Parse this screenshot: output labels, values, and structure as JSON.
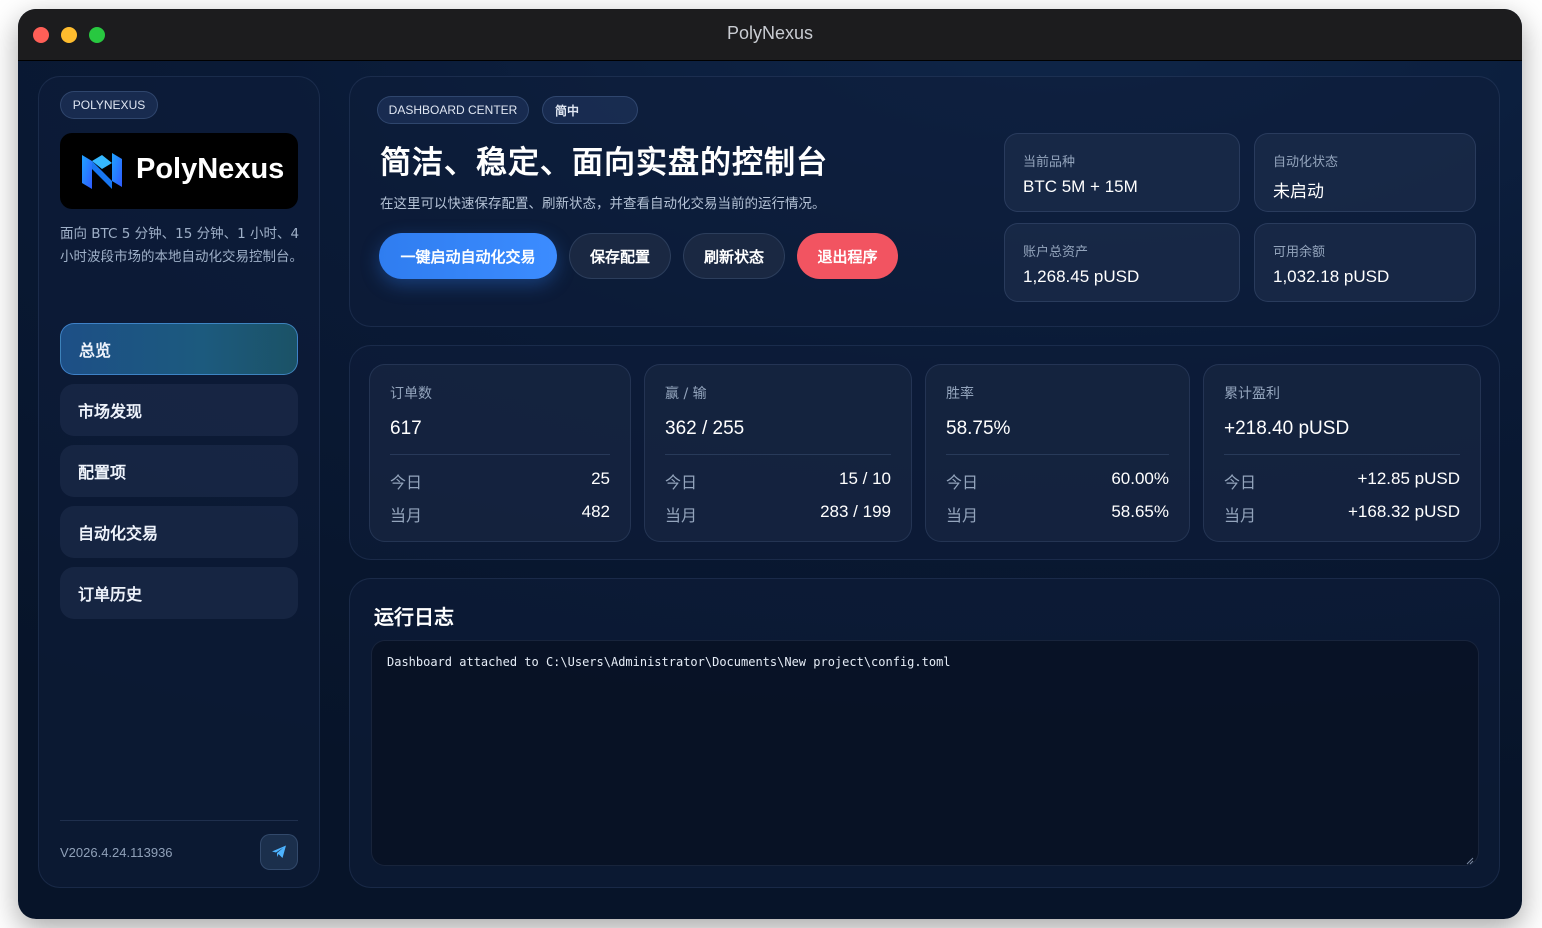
{
  "window": {
    "title": "PolyNexus"
  },
  "sidebar": {
    "badge": "POLYNEXUS",
    "logo_text": "PolyNexus",
    "description": "面向 BTC 5 分钟、15 分钟、1 小时、4 小时波段市场的本地自动化交易控制台。",
    "items": [
      {
        "label": "总览",
        "active": true
      },
      {
        "label": "市场发现",
        "active": false
      },
      {
        "label": "配置项",
        "active": false
      },
      {
        "label": "自动化交易",
        "active": false
      },
      {
        "label": "订单历史",
        "active": false
      }
    ],
    "version": "V2026.4.24.113936",
    "telegram_icon": "paper-plane-icon"
  },
  "hero": {
    "tag": "DASHBOARD CENTER",
    "lang": "简中",
    "title": "简洁、稳定、面向实盘的控制台",
    "subtitle": "在这里可以快速保存配置、刷新状态，并查看自动化交易当前的运行情况。",
    "buttons": {
      "start": "一键启动自动化交易",
      "save": "保存配置",
      "refresh": "刷新状态",
      "exit": "退出程序"
    },
    "cards": [
      {
        "label": "当前品种",
        "value": "BTC 5M + 15M"
      },
      {
        "label": "自动化状态",
        "value": "未启动"
      },
      {
        "label": "账户总资产",
        "value": "1,268.45 pUSD"
      },
      {
        "label": "可用余额",
        "value": "1,032.18 pUSD"
      }
    ]
  },
  "stats": [
    {
      "label": "订单数",
      "value": "617",
      "today_label": "今日",
      "today": "25",
      "month_label": "当月",
      "month": "482"
    },
    {
      "label": "赢 / 输",
      "value": "362 / 255",
      "today_label": "今日",
      "today": "15 / 10",
      "month_label": "当月",
      "month": "283 / 199"
    },
    {
      "label": "胜率",
      "value": "58.75%",
      "today_label": "今日",
      "today": "60.00%",
      "month_label": "当月",
      "month": "58.65%"
    },
    {
      "label": "累计盈利",
      "value": "+218.40 pUSD",
      "today_label": "今日",
      "today": "+12.85 pUSD",
      "month_label": "当月",
      "month": "+168.32 pUSD"
    }
  ],
  "log": {
    "title": "运行日志",
    "content": "Dashboard attached to C:\\Users\\Administrator\\Documents\\New project\\config.toml"
  },
  "colors": {
    "accent": "#3c8cff",
    "danger": "#f25461",
    "background": "#0a1a36"
  }
}
